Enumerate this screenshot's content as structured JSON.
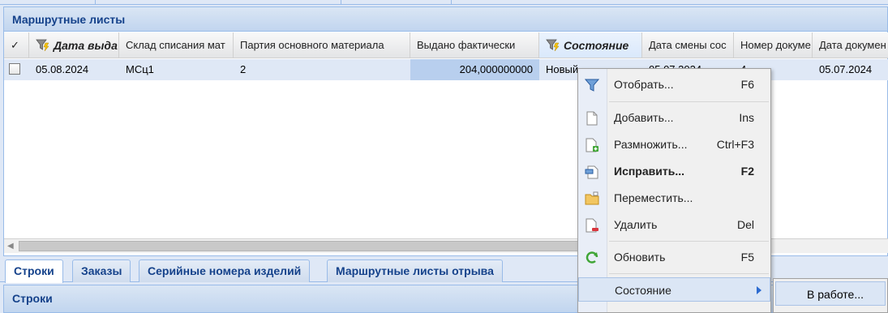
{
  "panel": {
    "title": "Маршрутные листы"
  },
  "grid": {
    "columns": [
      {
        "label": "✓"
      },
      {
        "label": "Дата выда"
      },
      {
        "label": "Склад списания мат"
      },
      {
        "label": "Партия основного материала"
      },
      {
        "label": "Выдано фактически"
      },
      {
        "label": "Состояние"
      },
      {
        "label": "Дата смены сос"
      },
      {
        "label": "Номер докуме"
      },
      {
        "label": "Дата докумен"
      }
    ],
    "row": {
      "date": "05.08.2024",
      "warehouse": "МСц1",
      "batch": "2",
      "issued": "204,000000000",
      "state": "Новый",
      "state_date": "05.07.2024",
      "doc_number": "4",
      "doc_date": "05.07.2024"
    }
  },
  "tabs": [
    {
      "label": "Строки"
    },
    {
      "label": "Заказы"
    },
    {
      "label": "Серийные номера изделий"
    },
    {
      "label": "Маршрутные листы отрыва"
    }
  ],
  "lower_panel": {
    "title": "Строки"
  },
  "context_menu": [
    {
      "label": "Отобрать...",
      "key": "F6",
      "icon": "filter-icon"
    },
    {
      "label": "Добавить...",
      "key": "Ins",
      "icon": "document-icon"
    },
    {
      "label": "Размножить...",
      "key": "Ctrl+F3",
      "icon": "document-add-icon"
    },
    {
      "label": "Исправить...",
      "key": "F2",
      "icon": "edit-icon"
    },
    {
      "label": "Переместить...",
      "key": "",
      "icon": "folder-icon"
    },
    {
      "label": "Удалить",
      "key": "Del",
      "icon": "document-delete-icon"
    },
    {
      "label": "Обновить",
      "key": "F5",
      "icon": "refresh-icon"
    },
    {
      "label": "Состояние",
      "key": "",
      "icon": ""
    }
  ],
  "submenu": {
    "label": "В работе..."
  },
  "colors": {
    "header_text": "#15428b",
    "row_bg": "#dfe8f6",
    "selected_cell": "#b8cfee"
  }
}
